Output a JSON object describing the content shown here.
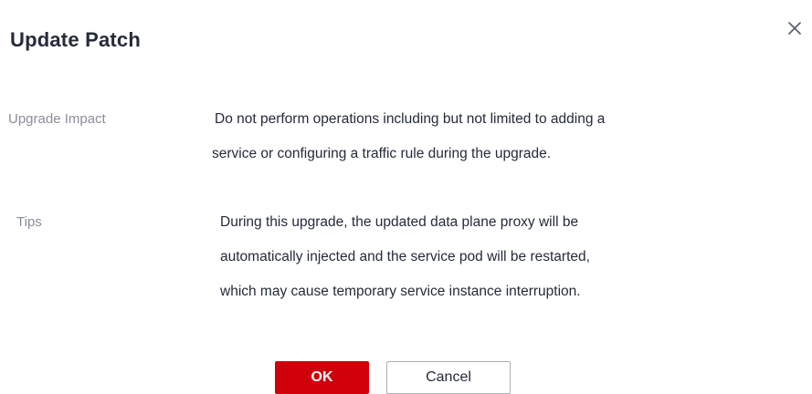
{
  "dialog": {
    "title": "Update Patch",
    "close_icon": "close-icon"
  },
  "fields": {
    "impact": {
      "label": "Upgrade Impact",
      "lines": [
        "Do not perform operations including but not limited to adding a",
        "service or  configuring a traffic rule during the upgrade."
      ]
    },
    "tips": {
      "label": "Tips",
      "lines": [
        "During this upgrade, the updated data plane proxy will be",
        "automatically injected  and the service pod will be restarted,",
        "which may cause temporary service instance interruption."
      ]
    }
  },
  "buttons": {
    "ok_label": "OK",
    "cancel_label": "Cancel"
  },
  "colors": {
    "primary": "#d0000b",
    "text": "#252b3a",
    "label": "#8a8e99"
  }
}
